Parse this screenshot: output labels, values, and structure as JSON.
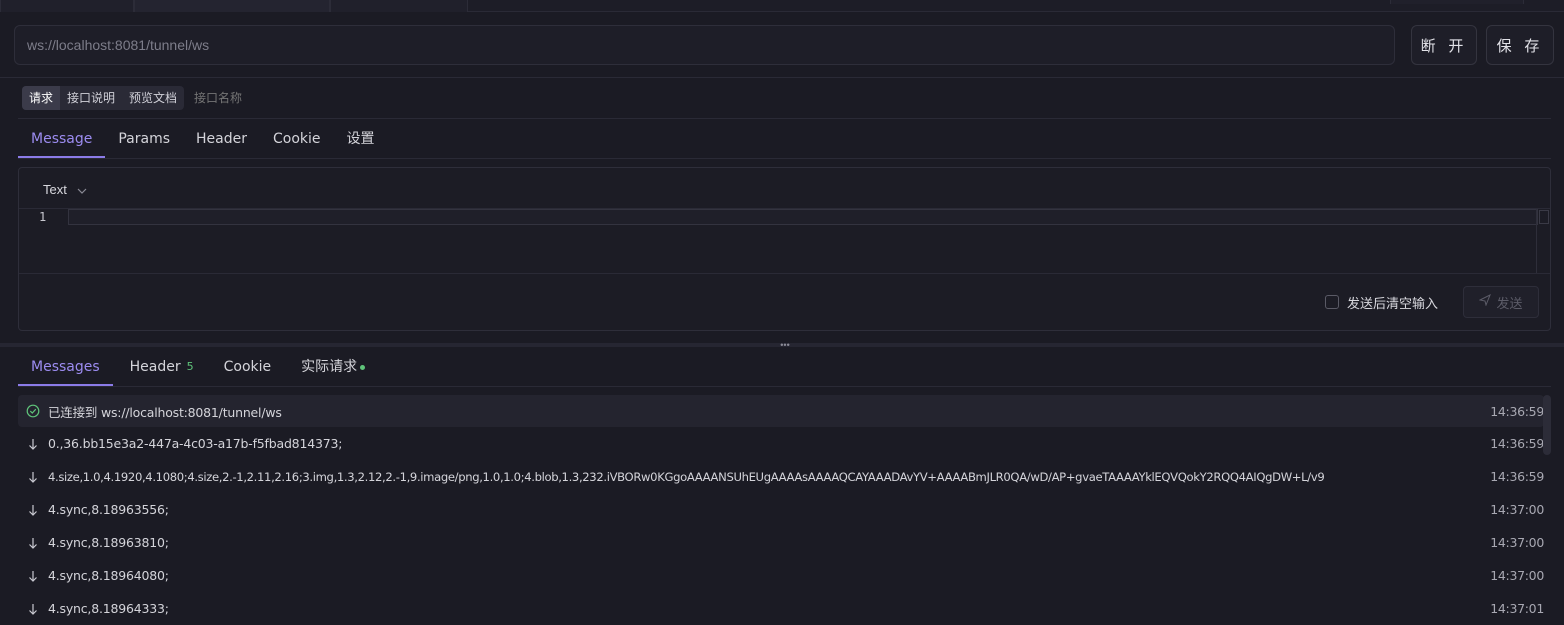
{
  "url_bar": {
    "value": "ws://localhost:8081/tunnel/ws",
    "disconnect_label": "断 开",
    "save_label": "保 存"
  },
  "doc_tabs": {
    "items": [
      "请求",
      "接口说明",
      "预览文档"
    ],
    "active": "请求",
    "name_placeholder": "接口名称"
  },
  "request_tabs": {
    "items": [
      "Message",
      "Params",
      "Header",
      "Cookie",
      "设置"
    ],
    "active": "Message"
  },
  "editor": {
    "type_value": "Text",
    "line_number": "1",
    "clear_after_send_label": "发送后清空输入",
    "clear_after_send_checked": false,
    "send_label": "发送"
  },
  "response_tabs": {
    "messages_label": "Messages",
    "header_label": "Header",
    "header_count": "5",
    "cookie_label": "Cookie",
    "actual_request_label": "实际请求",
    "active": "Messages"
  },
  "messages": [
    {
      "icon": "check-circle-icon",
      "text": "已连接到 ws://localhost:8081/tunnel/ws",
      "time": "14:36:59"
    },
    {
      "icon": "arrow-down-icon",
      "text": "0.,36.bb15e3a2-447a-4c03-a17b-f5fbad814373;",
      "time": "14:36:59"
    },
    {
      "icon": "arrow-down-icon",
      "text": "4.size,1.0,4.1920,4.1080;4.size,2.-1,2.11,2.16;3.img,1.3,2.12,2.-1,9.image/png,1.0,1.0;4.blob,1.3,232.iVBORw0KGgoAAAANSUhEUgAAAAsAAAAQCAYAAADAvYV+AAAABmJLR0QA/wD/AP+gvaeTAAAAYklEQVQokY2RQQ4AIQgDW+L/v9",
      "time": "14:36:59"
    },
    {
      "icon": "arrow-down-icon",
      "text": "4.sync,8.18963556;",
      "time": "14:37:00"
    },
    {
      "icon": "arrow-down-icon",
      "text": "4.sync,8.18963810;",
      "time": "14:37:00"
    },
    {
      "icon": "arrow-down-icon",
      "text": "4.sync,8.18964080;",
      "time": "14:37:00"
    },
    {
      "icon": "arrow-down-icon",
      "text": "4.sync,8.18964333;",
      "time": "14:37:01"
    }
  ],
  "colors": {
    "accent": "#8b7be8",
    "background": "#1b1b24",
    "success": "#5fc47a"
  }
}
